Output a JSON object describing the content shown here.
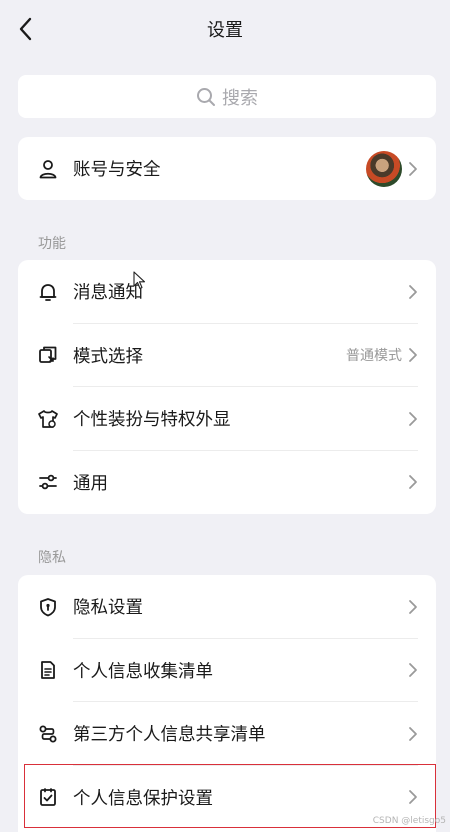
{
  "header": {
    "title": "设置",
    "back_icon": "chevron-left-icon"
  },
  "search": {
    "placeholder": "搜索",
    "icon": "search-icon"
  },
  "account": {
    "label": "账号与安全",
    "icon": "user-icon"
  },
  "sections": {
    "features": {
      "title": "功能",
      "items": [
        {
          "label": "消息通知",
          "icon": "bell-icon",
          "value": ""
        },
        {
          "label": "模式选择",
          "icon": "mode-switch-icon",
          "value": "普通模式"
        },
        {
          "label": "个性装扮与特权外显",
          "icon": "tshirt-icon",
          "value": ""
        },
        {
          "label": "通用",
          "icon": "sliders-icon",
          "value": ""
        }
      ]
    },
    "privacy": {
      "title": "隐私",
      "items": [
        {
          "label": "隐私设置",
          "icon": "shield-icon"
        },
        {
          "label": "个人信息收集清单",
          "icon": "document-icon"
        },
        {
          "label": "第三方个人信息共享清单",
          "icon": "share-nodes-icon"
        },
        {
          "label": "个人信息保护设置",
          "icon": "checklist-icon"
        }
      ]
    }
  },
  "watermark": "CSDN @letisgo5",
  "colors": {
    "background": "#f0f0f5",
    "card": "#ffffff",
    "highlight": "#d9303a",
    "muted": "#999999"
  }
}
